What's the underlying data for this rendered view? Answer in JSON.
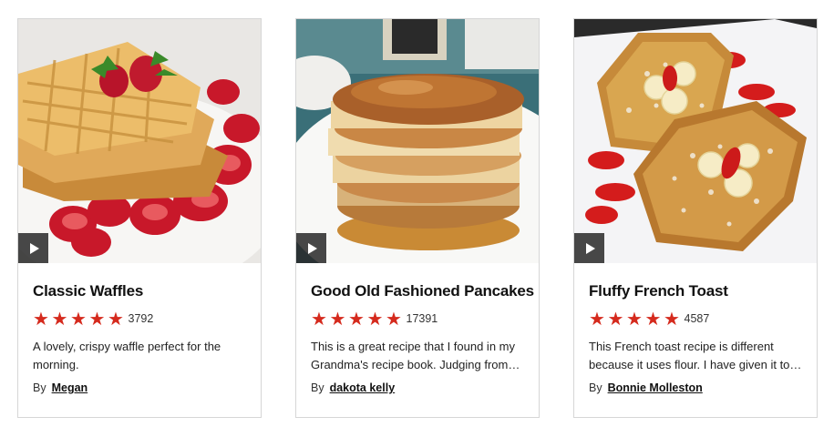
{
  "recipes": [
    {
      "title": "Classic Waffles",
      "rating": 5,
      "rating_count": "3792",
      "description": "A lovely, crispy waffle perfect for the morning.",
      "by_label": "By",
      "author": "Megan",
      "play_icon": "play-icon"
    },
    {
      "title": "Good Old Fashioned Pancakes",
      "rating": 5,
      "rating_count": "17391",
      "description": "This is a great recipe that I found in my Grandma's recipe book. Judging from…",
      "by_label": "By",
      "author": "dakota kelly",
      "play_icon": "play-icon"
    },
    {
      "title": "Fluffy French Toast",
      "rating": 5,
      "rating_count": "4587",
      "description": "This French toast recipe is different because it uses flour. I have given it to…",
      "by_label": "By",
      "author": "Bonnie Molleston",
      "play_icon": "play-icon"
    }
  ],
  "colors": {
    "star": "#d52a1d",
    "title": "#111111",
    "card_border": "#d6d6d6"
  }
}
